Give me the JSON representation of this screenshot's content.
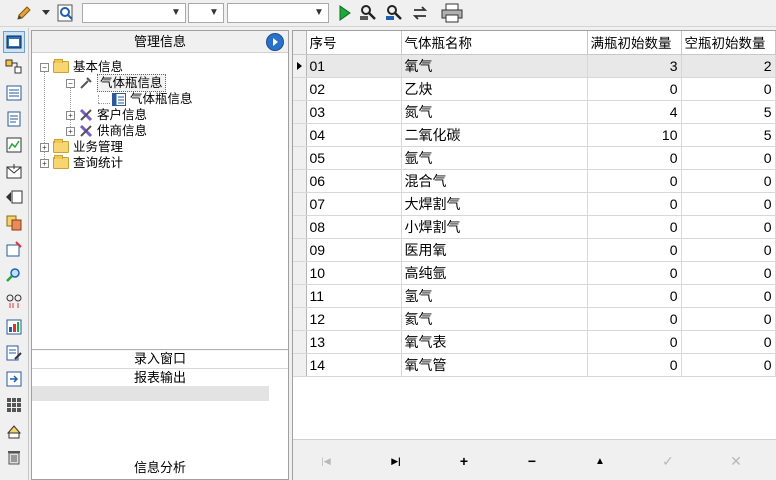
{
  "toolbar": {
    "combo1_value": "",
    "combo2_value": "",
    "combo3_value": ""
  },
  "icons": {
    "toolbar": [
      "pencil-icon",
      "dropdown-arrow-icon",
      "find-icon",
      "run-icon",
      "search-person-icon",
      "search-person-alt-icon",
      "refresh-icon",
      "print-icon"
    ],
    "vertical": [
      "window-icon",
      "tools-icon",
      "list-icon",
      "document-icon",
      "chart-icon",
      "envelope-icon",
      "forward-icon",
      "copy-icon",
      "settings-icon",
      "search-icon",
      "link-icon",
      "report-icon",
      "edit-doc-icon",
      "export-icon",
      "grid-icon",
      "key-doc-icon",
      "trash-icon"
    ]
  },
  "mgmt": {
    "title": "管理信息",
    "tree": {
      "basic": "基本信息",
      "cylinder_info": "气体瓶信息",
      "cylinder_info_leaf": "气体瓶信息",
      "customer": "客户信息",
      "supplier": "供商信息",
      "business": "业务管理",
      "query": "查询统计"
    },
    "sections": {
      "entry": "录入窗口",
      "report": "报表输出",
      "analysis": "信息分析"
    }
  },
  "grid": {
    "columns": [
      "序号",
      "气体瓶名称",
      "满瓶初始数量",
      "空瓶初始数量"
    ],
    "rows": [
      {
        "no": "01",
        "name": "氧气",
        "full": "3",
        "empty": "2"
      },
      {
        "no": "02",
        "name": "乙炔",
        "full": "0",
        "empty": "0"
      },
      {
        "no": "03",
        "name": "氮气",
        "full": "4",
        "empty": "5"
      },
      {
        "no": "04",
        "name": "二氧化碳",
        "full": "10",
        "empty": "5"
      },
      {
        "no": "05",
        "name": "氩气",
        "full": "0",
        "empty": "0"
      },
      {
        "no": "06",
        "name": "混合气",
        "full": "0",
        "empty": "0"
      },
      {
        "no": "07",
        "name": "大焊割气",
        "full": "0",
        "empty": "0"
      },
      {
        "no": "08",
        "name": "小焊割气",
        "full": "0",
        "empty": "0"
      },
      {
        "no": "09",
        "name": "医用氧",
        "full": "0",
        "empty": "0"
      },
      {
        "no": "10",
        "name": "高纯氩",
        "full": "0",
        "empty": "0"
      },
      {
        "no": "11",
        "name": "氢气",
        "full": "0",
        "empty": "0"
      },
      {
        "no": "12",
        "name": "氦气",
        "full": "0",
        "empty": "0"
      },
      {
        "no": "13",
        "name": "氧气表",
        "full": "0",
        "empty": "0"
      },
      {
        "no": "14",
        "name": "氧气管",
        "full": "0",
        "empty": "0"
      }
    ],
    "current_row": 0
  },
  "nav": {
    "first": "|◀",
    "last": "▶|",
    "add": "+",
    "delete": "−",
    "up": "▲",
    "post": "✓",
    "cancel": "✕"
  },
  "colors": {
    "accent": "#2a72c8",
    "folder": "#f7d570"
  }
}
